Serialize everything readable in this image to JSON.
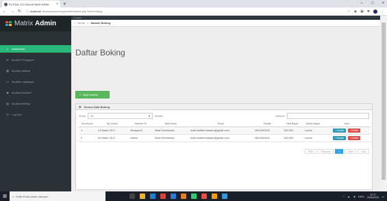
{
  "browser": {
    "tab_title": "FUTSAL ZO GALUH MAS KARA",
    "tab_close": "×",
    "new_tab": "+",
    "url_host": "localhost",
    "url_path": "/futsalpeserteo/ngicadmin/frame.php?text=boking",
    "window_controls": [
      "–",
      "□",
      "×"
    ]
  },
  "sidebar": {
    "brand_prefix": "Matrix",
    "brand_bold": "Admin",
    "items": [
      {
        "label": "Dashboard",
        "icon": "home-icon",
        "active": true
      },
      {
        "label": "Module Pengguna",
        "icon": "user-icon",
        "active": false
      },
      {
        "label": "Module Jadwal",
        "icon": "calendar-icon",
        "active": false
      },
      {
        "label": "Module Lapangan",
        "icon": "field-icon",
        "active": false
      },
      {
        "label": "Module Member",
        "icon": "member-icon",
        "active": false
      },
      {
        "label": "Module Boking",
        "icon": "booking-icon",
        "active": false
      },
      {
        "label": "Log Out",
        "icon": "logout-icon",
        "active": false
      }
    ]
  },
  "main": {
    "top_label": "7 Logout",
    "breadcrumb": {
      "home": "Home",
      "current": "Module Boking",
      "sep": ">"
    },
    "page_title": "Daftar Boking",
    "add_button": "Buat Invoice",
    "panel_title": "Semua Data Boking",
    "show_label": "Show",
    "show_value": "10",
    "entries_label": "entries",
    "search_label": "Search:",
    "columns": [
      "No Invoice",
      "Tgl Invoice",
      "Member ID",
      "Atas Nama",
      "Email",
      "Kontak",
      "Total Bayar",
      "Status Bayar",
      "Aksi"
    ],
    "rows": [
      [
        "1",
        "14 Maret 2017",
        "Bnagus12",
        "Budi Hermawan",
        "mail.budihermawan@gmail.com",
        "0821000011",
        "100.000",
        "Lunas"
      ],
      [
        "2",
        "15 Maret 2017",
        "admin",
        "Budi Hermawan",
        "mail.budihermawan@gmail.com",
        "0821000011",
        "100.000",
        "Lunas"
      ]
    ],
    "detail_label": "Details",
    "delete_label": "Delete",
    "pager": [
      "First",
      "Previous",
      "1",
      "Next",
      "Last"
    ]
  },
  "taskbar": {
    "search_placeholder": "Ketik di sini untuk mencari",
    "time": "22.37",
    "date": "25/06/2020",
    "lang": "ENG"
  },
  "colors": {
    "sidebar_bg": "#2b3135",
    "active_item": "#28b779",
    "add_button": "#5cb85c",
    "detail_button": "#2f96b4",
    "delete_button": "#da4f49",
    "pager_active": "#2fa4e7"
  }
}
